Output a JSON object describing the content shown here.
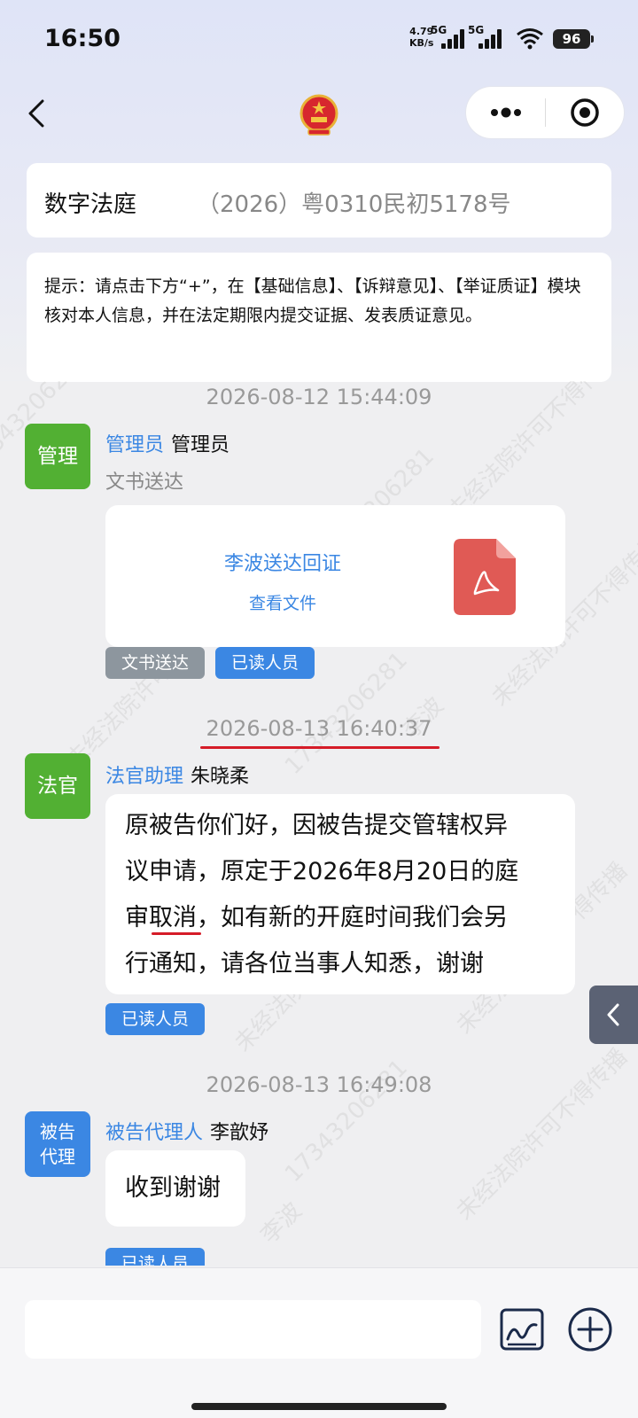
{
  "status": {
    "time": "16:50",
    "net_speed_value": "4.79",
    "net_speed_unit": "KB/s",
    "sim1_label": "5G",
    "sim2_label": "5G",
    "battery": "96"
  },
  "header": {
    "title": "数字法庭",
    "case_number": "（2026）粤0310民初5178号"
  },
  "hint": {
    "text": "提示：请点击下方“+”，在【基础信息】、【诉辩意见】、【举证质证】模块核对本人信息，并在法定期限内提交证据、发表质证意见。"
  },
  "watermark": {
    "court_text": "未经法院许可不得传播",
    "user_name": "李波",
    "user_id": "17343206281"
  },
  "messages": [
    {
      "timestamp": "2026-08-12 15:44:09",
      "avatar_label": "管理",
      "role": "管理员",
      "name": "管理员",
      "subtype": "文书送达",
      "file_name": "李波送达回证",
      "file_action": "查看文件",
      "tags": [
        "文书送达",
        "已读人员"
      ]
    },
    {
      "timestamp": "2026-08-13 16:40:37",
      "avatar_label": "法官",
      "role": "法官助理",
      "name": "朱晓柔",
      "lines": [
        "原被告你们好，因被告提交管辖权异",
        "议申请，原定于2026年8月20日的庭",
        "审取消，如有新的开庭时间我们会另",
        "行通知，请各位当事人知悉，谢谢"
      ],
      "tags": [
        "已读人员"
      ]
    },
    {
      "timestamp": "2026-08-13 16:49:08",
      "avatar_label_line1": "被告",
      "avatar_label_line2": "代理",
      "role": "被告代理人",
      "name": "李歆妤",
      "text": "收到谢谢",
      "tags": [
        "已读人员"
      ]
    }
  ],
  "composer": {
    "placeholder": ""
  },
  "colors": {
    "accent_blue": "#3b87e3",
    "avatar_green": "#52b033",
    "tag_gray": "#8d969e",
    "pdf_red": "#e05a55",
    "underline_red": "#d51c28"
  },
  "icons": {
    "back": "chevron-left-icon",
    "emblem": "national-emblem-icon",
    "more": "more-dots-icon",
    "close": "target-close-icon",
    "pdf": "pdf-file-icon",
    "side": "chevron-left-icon",
    "sign": "signature-icon",
    "plus": "plus-circle-icon"
  }
}
